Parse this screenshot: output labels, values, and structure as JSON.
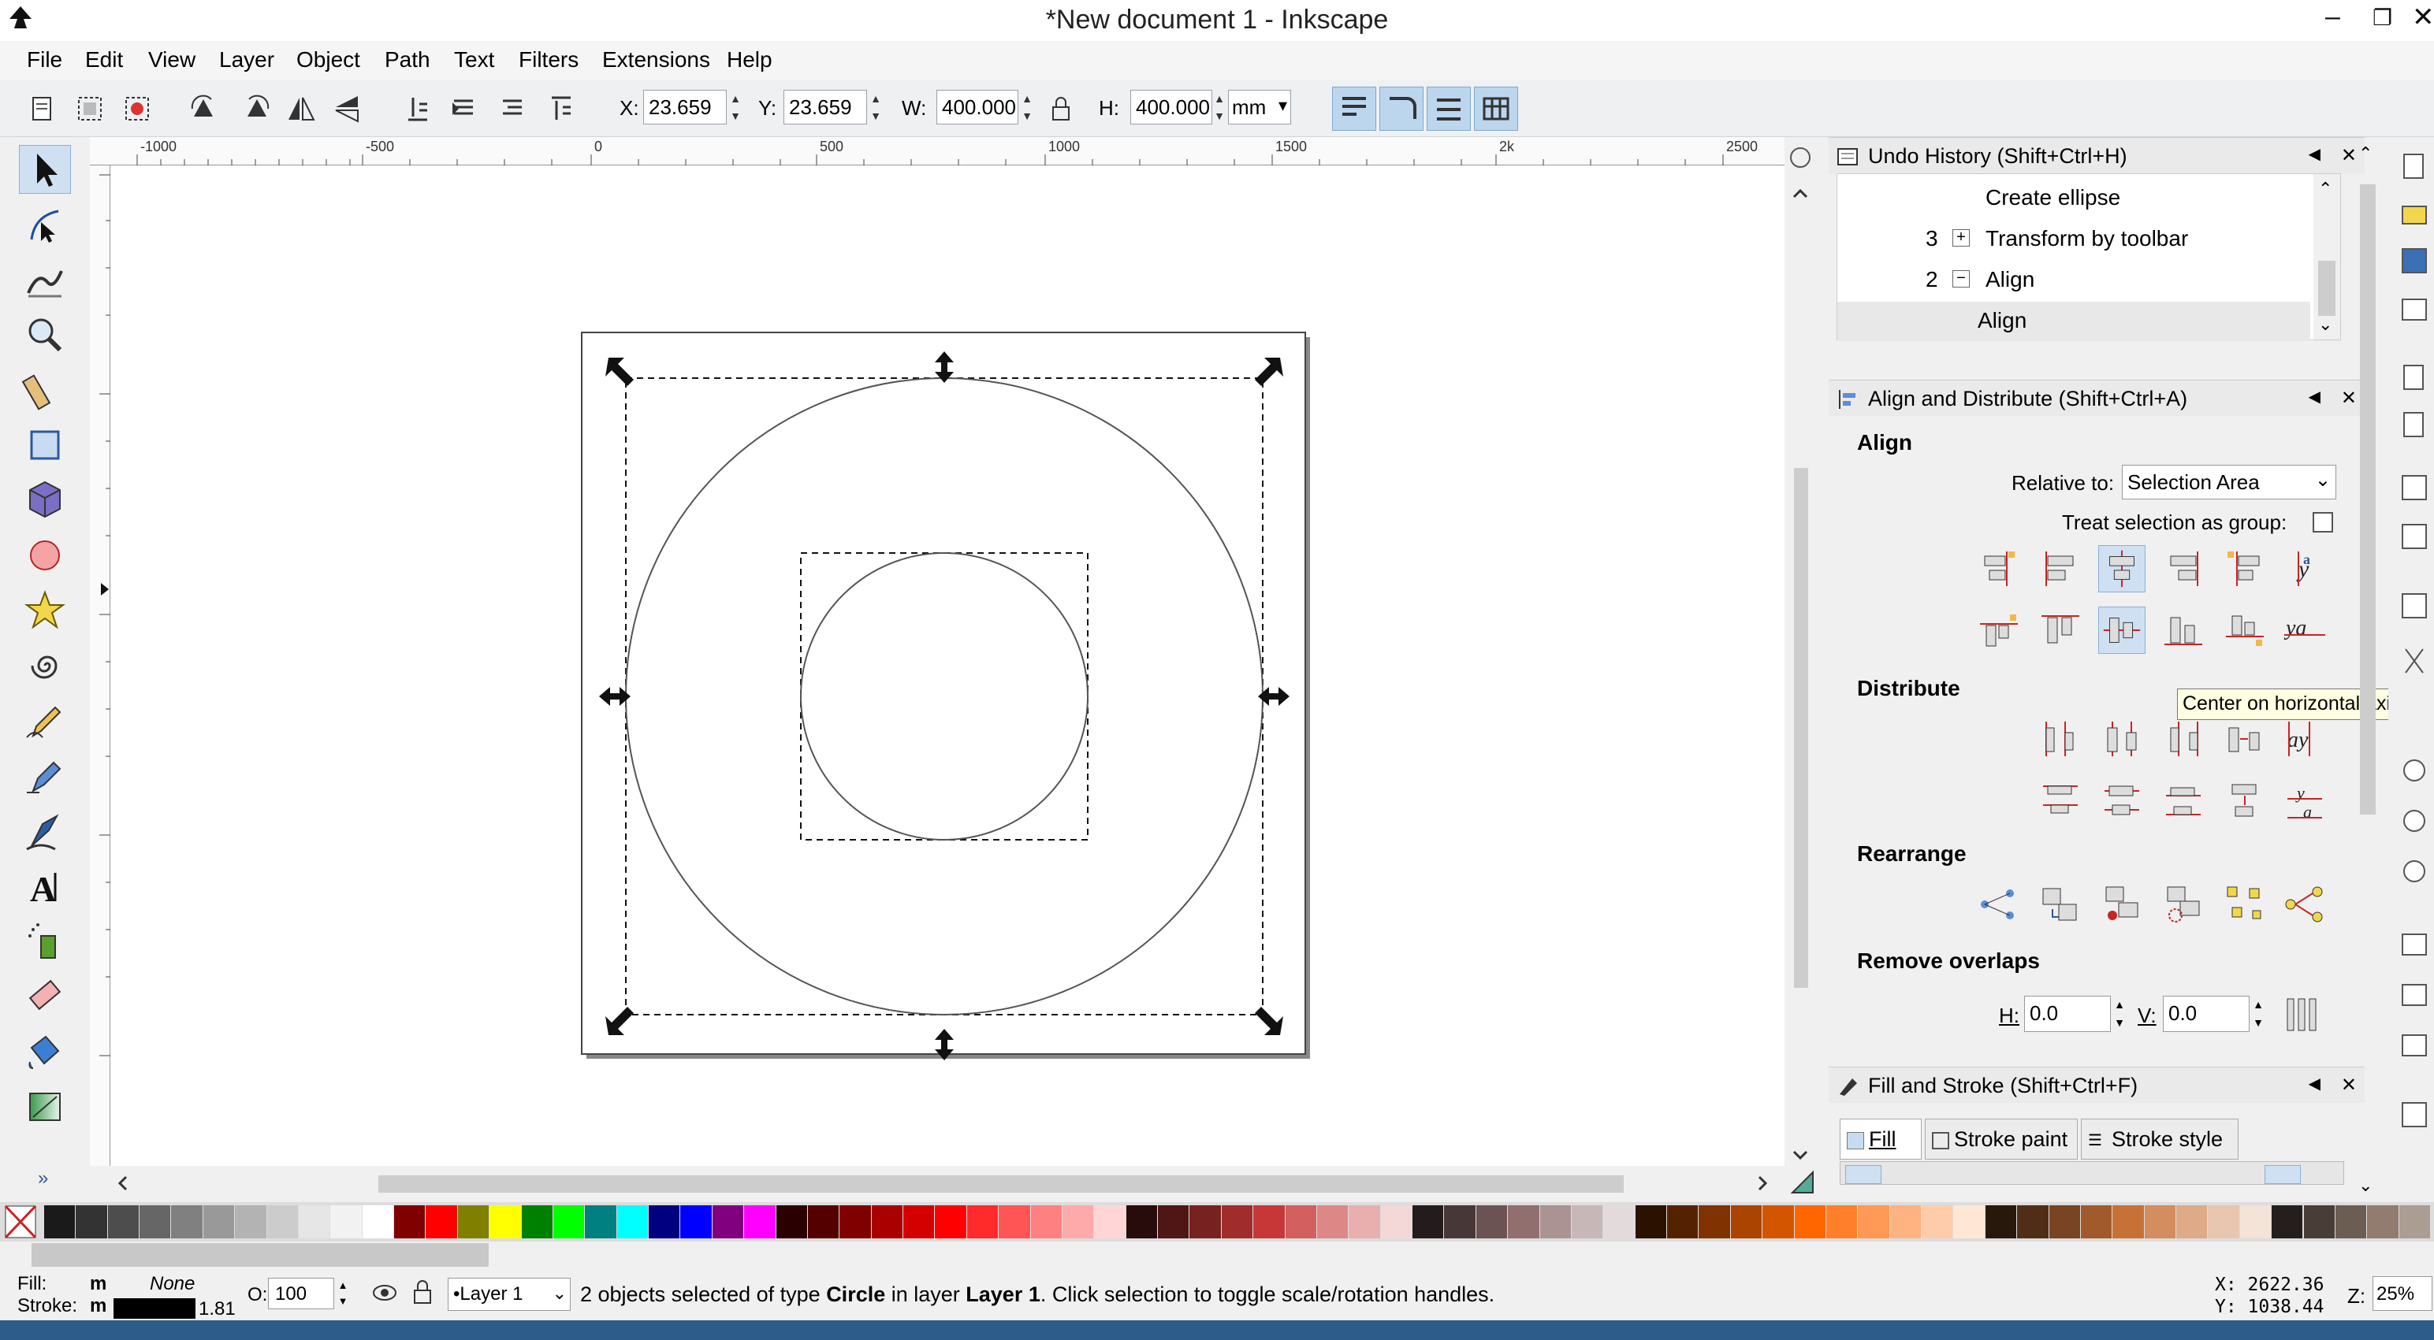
{
  "window": {
    "title": "*New document 1 - Inkscape",
    "min": "–",
    "max": "❐",
    "close": "✕"
  },
  "menu": [
    "File",
    "Edit",
    "View",
    "Layer",
    "Object",
    "Path",
    "Text",
    "Filters",
    "Extensions",
    "Help"
  ],
  "toolctl": {
    "x_label": "X:",
    "x_value": "23.659",
    "y_label": "Y:",
    "y_value": "23.659",
    "w_label": "W:",
    "w_value": "400.000",
    "h_label": "H:",
    "h_value": "400.000",
    "unit": "mm"
  },
  "ruler": {
    "labels": [
      "-1000",
      "-500",
      "0",
      "500",
      "1000",
      "1500",
      "2k",
      "2500"
    ]
  },
  "undo": {
    "title": "Undo History (Shift+Ctrl+H)",
    "items": [
      {
        "num": "",
        "label": "Create ellipse"
      },
      {
        "num": "3",
        "label": "Transform by toolbar"
      },
      {
        "num": "2",
        "label": "Align"
      },
      {
        "num": "",
        "label": "Align"
      }
    ]
  },
  "align": {
    "title": "Align and Distribute (Shift+Ctrl+A)",
    "align_heading": "Align",
    "relative_label": "Relative to:",
    "relative_value": "Selection Area",
    "treat_group_label": "Treat selection as group:",
    "tooltip": "Center on horizontal axis",
    "distribute_heading": "Distribute",
    "rearrange_heading": "Rearrange",
    "overlaps_heading": "Remove overlaps",
    "h_label": "H:",
    "h_value": "0.0",
    "v_label": "V:",
    "v_value": "0.0"
  },
  "fillstroke": {
    "title": "Fill and Stroke (Shift+Ctrl+F)",
    "tabs": [
      "Fill",
      "Stroke paint",
      "Stroke style"
    ]
  },
  "status": {
    "fill_label": "Fill:",
    "fill_value": "m",
    "fill_none": "None",
    "stroke_label": "Stroke:",
    "stroke_value": "m",
    "stroke_width": "1.81",
    "opacity_label": "O:",
    "opacity_value": "100",
    "layer": "•Layer 1",
    "message_pre": "2 objects selected of type ",
    "message_type": "Circle",
    "message_mid": " in layer ",
    "message_layer": "Layer 1",
    "message_post": ". Click selection to toggle scale/rotation handles.",
    "coord_x": "X: 2622.36",
    "coord_y": "Y: 1038.44",
    "zoom_label": "Z:",
    "zoom_value": "25%"
  },
  "palette": [
    "#1a1a1a",
    "#333333",
    "#4d4d4d",
    "#666666",
    "#808080",
    "#999999",
    "#b3b3b3",
    "#cccccc",
    "#e6e6e6",
    "#f2f2f2",
    "#ffffff",
    "#800000",
    "#ff0000",
    "#808000",
    "#ffff00",
    "#008000",
    "#00ff00",
    "#008080",
    "#00ffff",
    "#000080",
    "#0000ff",
    "#800080",
    "#ff00ff",
    "#2b0000",
    "#550000",
    "#800000",
    "#aa0000",
    "#d40000",
    "#ff0000",
    "#ff2a2a",
    "#ff5555",
    "#ff8080",
    "#ffaaaa",
    "#ffd5d5",
    "#280b0b",
    "#501616",
    "#782121",
    "#a02c2c",
    "#c83737",
    "#d35f5f",
    "#de8787",
    "#e9afaf",
    "#f4d7d7",
    "#241c1c",
    "#483737",
    "#6c5353",
    "#916f6f",
    "#ac9393",
    "#c8b7b7",
    "#e3dbdb",
    "#2b1100",
    "#552200",
    "#803300",
    "#aa4400",
    "#d45500",
    "#ff6600",
    "#ff7f2a",
    "#ff9955",
    "#ffb380",
    "#ffccaa",
    "#ffe6d5",
    "#28170b",
    "#502d16",
    "#784421",
    "#a05a2c",
    "#c87137",
    "#d38d5f",
    "#deaa87",
    "#e9c6af",
    "#f4e3d7",
    "#241f1c",
    "#483e37",
    "#6c5d53",
    "#917c6f",
    "#ac9d93"
  ],
  "icons": [
    "select-tool",
    "node-tool",
    "tweak-tool",
    "zoom-tool",
    "measure-tool",
    "rect-tool",
    "3dbox-tool",
    "ellipse-tool",
    "star-tool",
    "spiral-tool",
    "pencil-tool",
    "pen-tool",
    "calligraphy-tool",
    "text-tool",
    "spray-tool",
    "eraser-tool",
    "bucket-tool",
    "gradient-tool"
  ]
}
